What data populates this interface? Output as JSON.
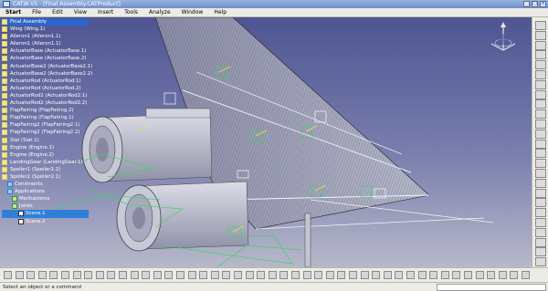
{
  "window": {
    "title": "CATIA V5 - [Final Assembly.CATProduct]"
  },
  "menu": [
    {
      "label": "Start"
    },
    {
      "label": "File"
    },
    {
      "label": "Edit"
    },
    {
      "label": "View"
    },
    {
      "label": "Insert"
    },
    {
      "label": "Tools"
    },
    {
      "label": "Analyze"
    },
    {
      "label": "Window"
    },
    {
      "label": "Help"
    }
  ],
  "tree": {
    "root": "Final Assembly",
    "items": [
      "Wing (Wing.1)",
      "Aileron1 (Aileron1.1)",
      "Aileron1 (Aileron1.1)",
      "ActuatorBase (ActuatorBase.1)",
      "ActuatorBase (ActuatorBase.2)",
      "ActuatorBase2 (ActuatorBase2.1)",
      "ActuatorBase2 (ActuatorBase2.2)",
      "ActuatorRod (ActuatorRod.1)",
      "ActuatorRod (ActuatorRod.2)",
      "ActuatorRod2 (ActuatorRod2.1)",
      "ActuatorRod2 (ActuatorRod2.2)",
      "FlapFairing (FlapFairing.2)",
      "FlapFairing (FlapFairing.1)",
      "FlapFairing2 (FlapFairing2.1)",
      "FlapFairing2 (FlapFairing2.2)",
      "Slat (Slat.1)",
      "Engine (Engine.1)",
      "Engine (Engine.2)",
      "LandingGear (LandingGear.1)",
      "Spoiler1 (Spoiler1.2)",
      "Spoiler2 (Spoiler2.1)"
    ],
    "constraints": "Constraints",
    "applications": "Applications",
    "mechanisms": "Mechanisms",
    "joints": "Joints",
    "scenes": [
      "Scene.1",
      "Scene.2"
    ]
  },
  "status": {
    "prompt": "Select an object or a command"
  },
  "colors": {
    "viewport_top": "#4e5592",
    "viewport_bottom": "#b7b8c9",
    "tree_selection": "#2b66c9"
  },
  "icons": {
    "right_toolbar": [
      "select-icon",
      "fly-mode-icon",
      "pan-icon",
      "rotate-icon",
      "zoom-icon",
      "normal-view-icon",
      "multi-view-icon",
      "iso-view-icon",
      "render-icon",
      "hide-show-icon",
      "swap-icon",
      "measure-icon",
      "constraint-icon",
      "fix-icon",
      "coincidence-icon",
      "contact-icon",
      "offset-icon",
      "angle-icon",
      "update-icon",
      "explode-icon",
      "snap-icon",
      "manipulate-icon",
      "clash-icon",
      "section-icon",
      "distance-icon"
    ],
    "bottom_toolbar": [
      "new-icon",
      "open-icon",
      "save-icon",
      "print-icon",
      "cut-icon",
      "copy-icon",
      "paste-icon",
      "undo-icon",
      "redo-icon",
      "whats-this-icon",
      "formula-icon",
      "catalog-icon",
      "product-icon",
      "component-icon",
      "part-icon",
      "existing-component-icon",
      "replace-icon",
      "reorder-icon",
      "numbering-icon",
      "bom-icon",
      "scene-icon",
      "group-icon",
      "annotation-icon",
      "weld-icon",
      "measure-between-icon",
      "measure-item-icon",
      "measure-inertia-icon",
      "sketch-icon",
      "pad-icon",
      "flag-icon",
      "plot-icon",
      "simulation-icon",
      "sectioning-icon",
      "explode-view-icon",
      "tools-icon",
      "display-icon",
      "wireframe-icon",
      "light-icon",
      "color-icon",
      "render-style-icon",
      "camera-icon",
      "grid-icon",
      "swap-visible-icon",
      "hide-icon",
      "normal-icon",
      "fit-all-icon"
    ]
  }
}
